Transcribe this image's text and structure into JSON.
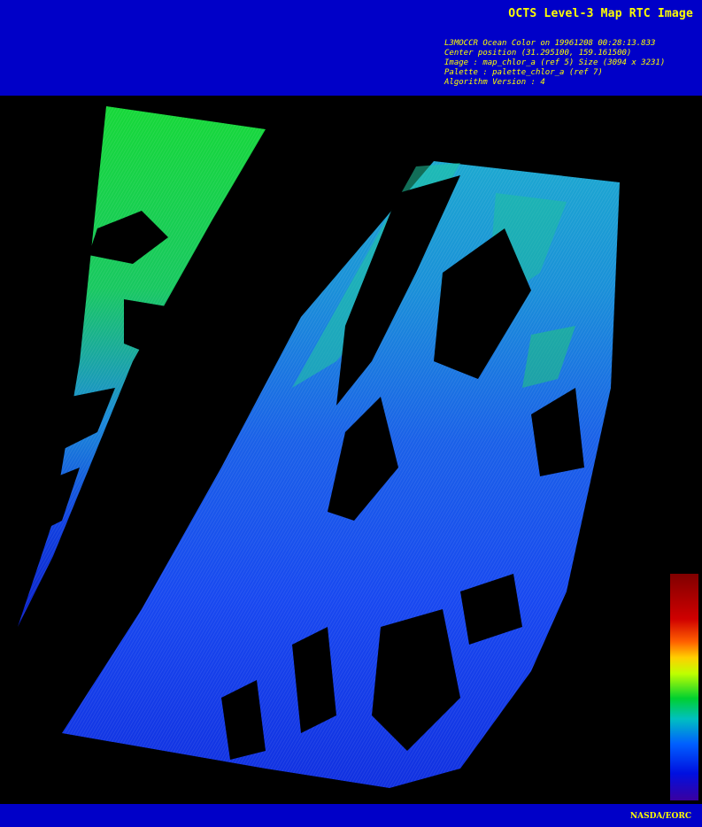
{
  "header": {
    "title": "OCTS Level-3 Map RTC Image",
    "meta_lines": [
      "L3MOCCR Ocean Color on 19961208 00:28:13.833",
      "Center position (31.295100, 159.161500)",
      "Image : map_chlor_a (ref 5) Size (3094 x 3231)",
      "Palette : palette_chlor_a (ref 7)",
      "Algorithm Version : 4"
    ]
  },
  "footer": {
    "credit": "NASDA/EORC"
  },
  "colors": {
    "banner": "#0000c8",
    "text": "#ffff00",
    "background": "#000000",
    "palette": [
      "#3a00a0",
      "#0010e0",
      "#0060ff",
      "#00c0c0",
      "#00d030",
      "#c0ff00",
      "#ffd000",
      "#ff6000",
      "#d00000",
      "#800000"
    ]
  }
}
